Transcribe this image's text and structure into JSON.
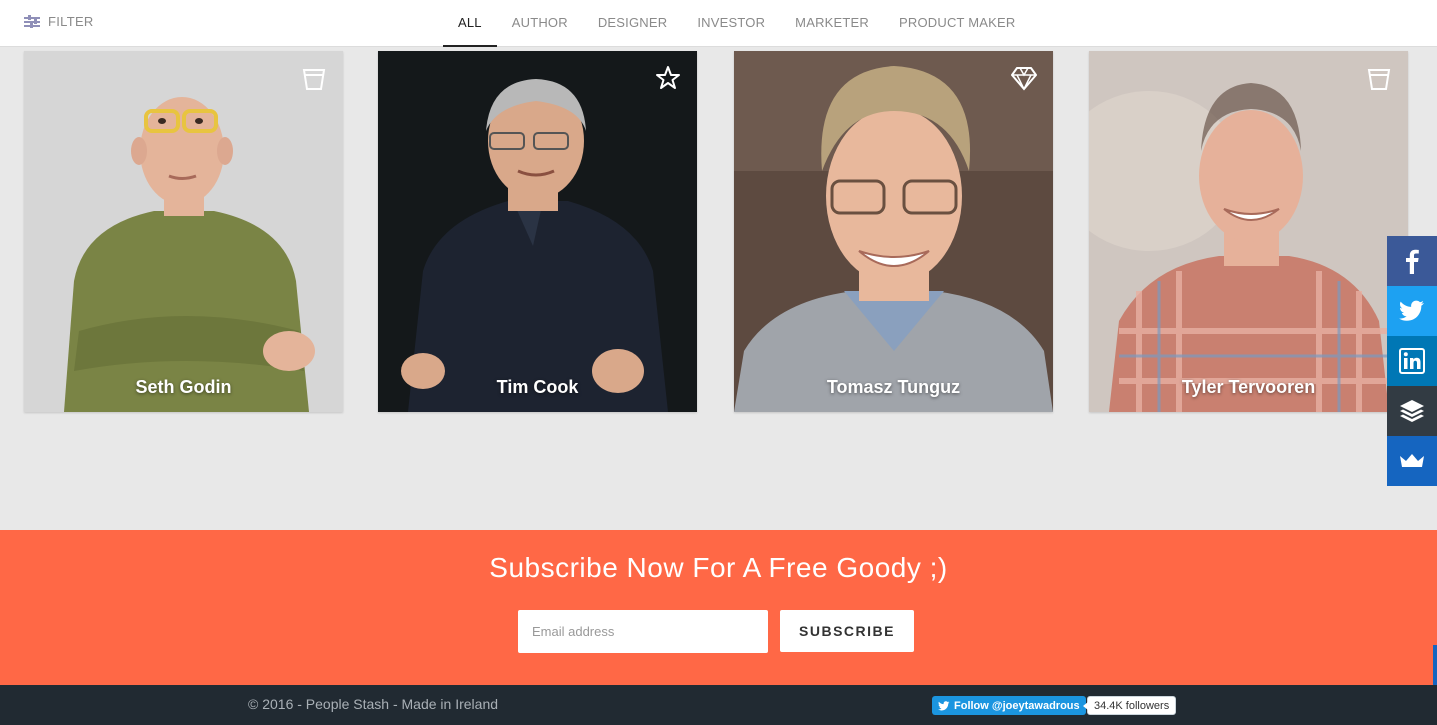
{
  "topbar": {
    "filter_label": "FILTER",
    "tabs": [
      "ALL",
      "AUTHOR",
      "DESIGNER",
      "INVESTOR",
      "MARKETER",
      "PRODUCT MAKER"
    ],
    "active_tab": "ALL"
  },
  "people": [
    {
      "name": "Seth Godin",
      "badge": "cup-icon",
      "bg": "#d6d6d6",
      "shirt": "#7a8445",
      "skin": "#e4b49a",
      "hair": "none"
    },
    {
      "name": "Tim Cook",
      "badge": "star-icon",
      "bg": "#14181a",
      "shirt": "#1d2330",
      "skin": "#d9a88a",
      "hair": "#b8b8b8"
    },
    {
      "name": "Tomasz Tunguz",
      "badge": "diamond-icon",
      "bg": "#5d4a40",
      "shirt": "#8aa0be",
      "skin": "#e8b89c",
      "hair": "#b8a27c"
    },
    {
      "name": "Tyler Tervooren",
      "badge": "cup-icon",
      "bg": "#cfc6c0",
      "shirt": "#c98070",
      "skin": "#e6b19a",
      "hair": "#5a4538"
    }
  ],
  "social": [
    {
      "network": "facebook",
      "icon": "facebook-icon"
    },
    {
      "network": "twitter",
      "icon": "twitter-icon"
    },
    {
      "network": "linkedin",
      "icon": "linkedin-icon"
    },
    {
      "network": "buffer",
      "icon": "buffer-icon"
    },
    {
      "network": "sumome",
      "icon": "sumome-icon"
    }
  ],
  "subscribe": {
    "heading": "Subscribe Now For A Free Goody ;)",
    "email_placeholder": "Email address",
    "button_label": "SUBSCRIBE"
  },
  "footer": {
    "copyright": "© 2016 - People Stash - Made in Ireland",
    "follow_label": "Follow @joeytawadrous",
    "followers": "34.4K followers"
  },
  "colors": {
    "accent": "#ff6846",
    "footer": "#212a32",
    "page_bg": "#e8e8e8"
  }
}
